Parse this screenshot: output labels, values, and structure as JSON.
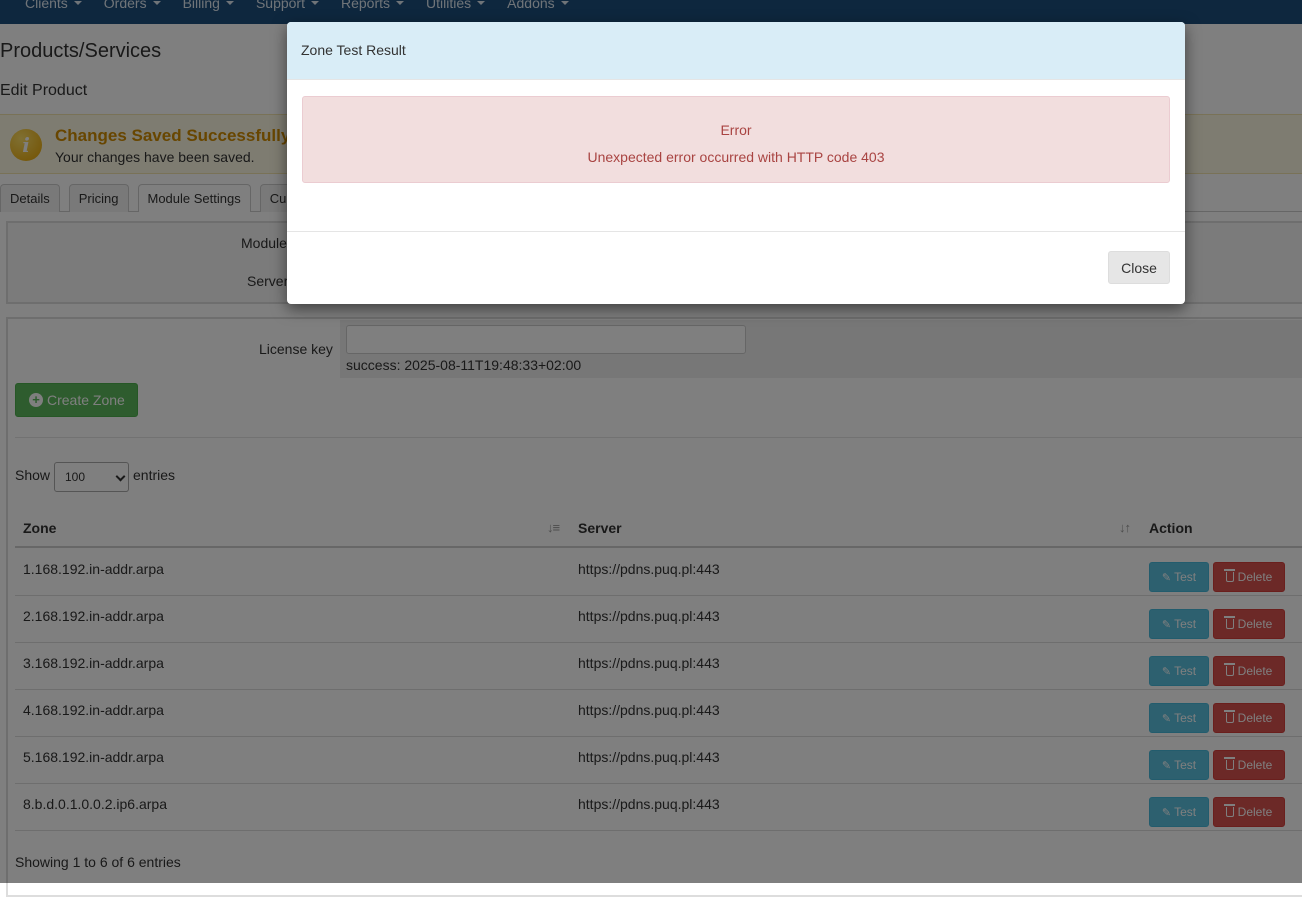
{
  "nav": {
    "items": [
      {
        "label": "Clients"
      },
      {
        "label": "Orders"
      },
      {
        "label": "Billing"
      },
      {
        "label": "Support"
      },
      {
        "label": "Reports"
      },
      {
        "label": "Utilities"
      },
      {
        "label": "Addons"
      }
    ]
  },
  "page": {
    "title": "Products/Services",
    "subtitle": "Edit Product"
  },
  "alert": {
    "title": "Changes Saved Successfully!",
    "text": "Your changes have been saved."
  },
  "tabs": [
    {
      "label": "Details"
    },
    {
      "label": "Pricing"
    },
    {
      "label": "Module Settings"
    },
    {
      "label": "Cu"
    }
  ],
  "module_box": {
    "module_label": "Module",
    "server_label": "Server"
  },
  "license": {
    "label": "License key",
    "value": "",
    "status": "success: 2025-08-11T19:48:33+02:00"
  },
  "create_zone": {
    "label": "Create Zone"
  },
  "entries": {
    "show_label": "Show",
    "selected": "100",
    "suffix": "entries"
  },
  "table": {
    "headers": {
      "zone": "Zone",
      "server": "Server",
      "action": "Action"
    },
    "rows": [
      {
        "zone": "1.168.192.in-addr.arpa",
        "server": "https://pdns.puq.pl:443"
      },
      {
        "zone": "2.168.192.in-addr.arpa",
        "server": "https://pdns.puq.pl:443"
      },
      {
        "zone": "3.168.192.in-addr.arpa",
        "server": "https://pdns.puq.pl:443"
      },
      {
        "zone": "4.168.192.in-addr.arpa",
        "server": "https://pdns.puq.pl:443"
      },
      {
        "zone": "5.168.192.in-addr.arpa",
        "server": "https://pdns.puq.pl:443"
      },
      {
        "zone": "8.b.d.0.1.0.0.2.ip6.arpa",
        "server": "https://pdns.puq.pl:443"
      }
    ],
    "test_label": "Test",
    "delete_label": "Delete",
    "info": "Showing 1 to 6 of 6 entries"
  },
  "modal": {
    "title": "Zone Test Result",
    "error_title": "Error",
    "error_message": "Unexpected error occurred with HTTP code 403",
    "close_label": "Close"
  },
  "colors": {
    "nav_bg": "#1d4e7d",
    "success_btn": "#5cb85c",
    "info_btn": "#5bc0de",
    "danger_btn": "#d9534f",
    "modal_header": "#d9edf7",
    "error_text": "#a94442"
  },
  "icons": {
    "alert": "info-icon",
    "create": "plus-circle-icon",
    "test": "pencil-icon",
    "delete": "trash-icon",
    "sort_zone": "sort-asc-icon",
    "sort_server": "sort-both-icon"
  }
}
